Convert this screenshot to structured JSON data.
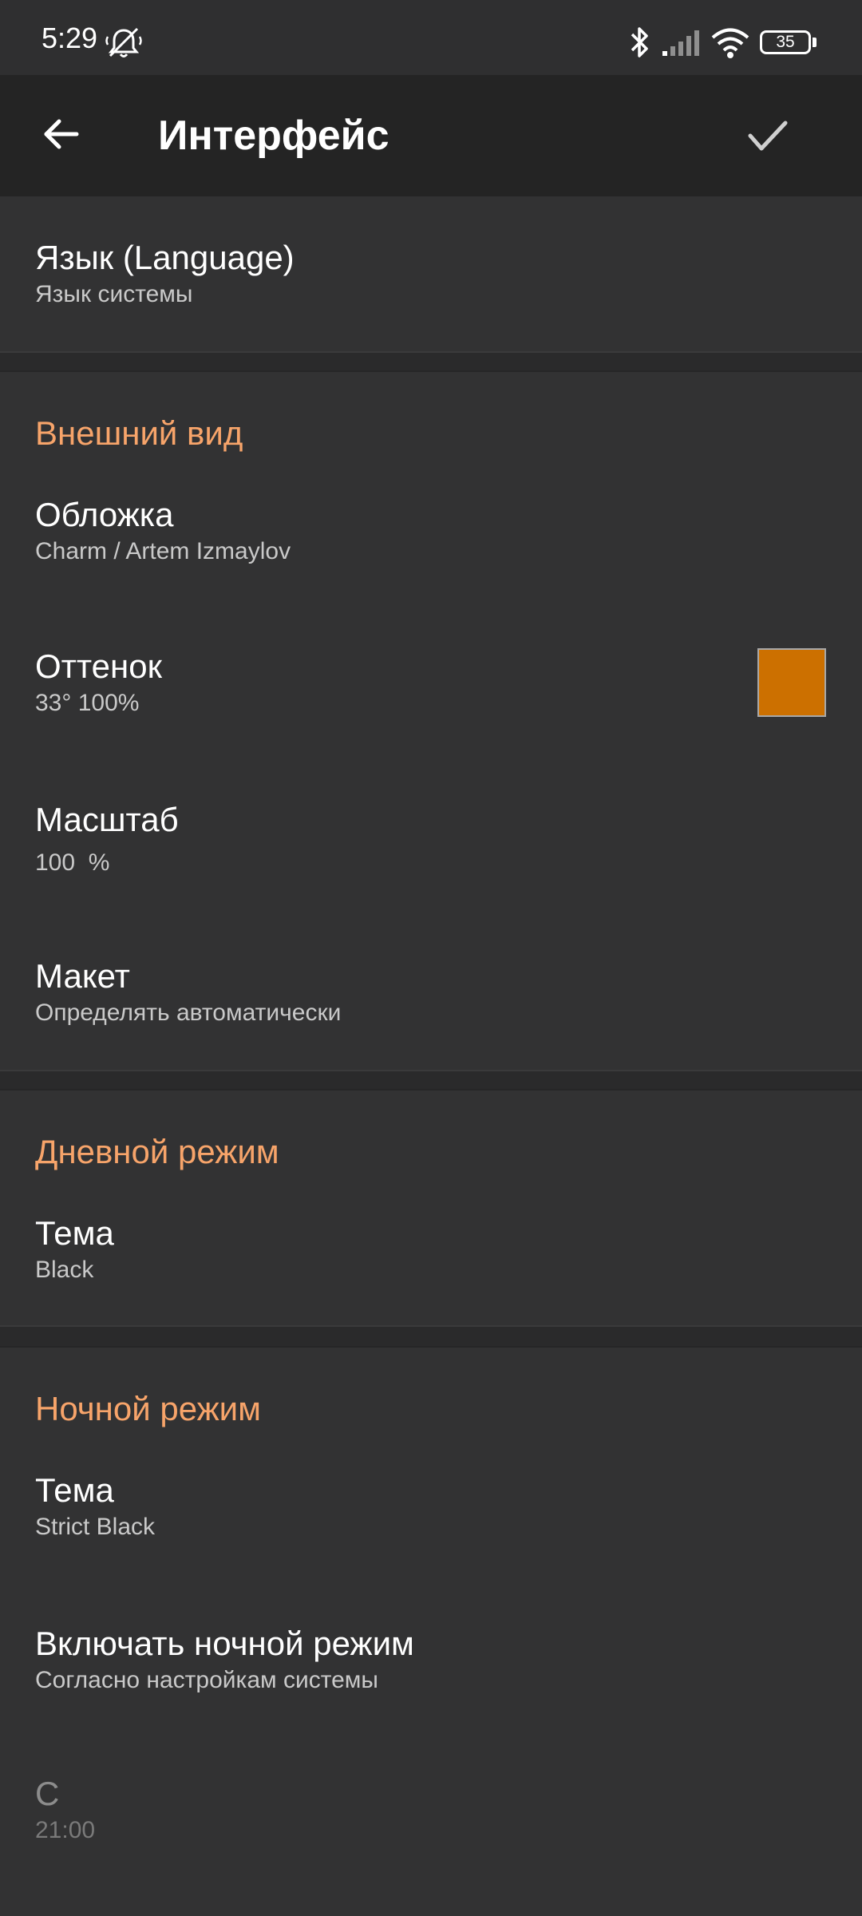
{
  "status_bar": {
    "time": "5:29",
    "battery": "35",
    "icons": [
      "mute-icon",
      "bluetooth-icon",
      "signal-icon",
      "wifi-icon",
      "battery-icon"
    ]
  },
  "app_bar": {
    "title": "Интерфейс",
    "back_icon": "arrow-left-icon",
    "confirm_icon": "check-icon"
  },
  "language": {
    "title": "Язык (Language)",
    "value": "Язык системы"
  },
  "appearance": {
    "header": "Внешний вид",
    "cover": {
      "title": "Обложка",
      "value": "Charm / Artem Izmaylov"
    },
    "tint": {
      "title": "Оттенок",
      "value": "33° 100%",
      "color": "#cc7000"
    },
    "scale": {
      "title": "Масштаб",
      "value": "100  %"
    },
    "layout": {
      "title": "Макет",
      "value": "Определять автоматически"
    }
  },
  "day_mode": {
    "header": "Дневной режим",
    "theme": {
      "title": "Тема",
      "value": "Black"
    }
  },
  "night_mode": {
    "header": "Ночной режим",
    "theme": {
      "title": "Тема",
      "value": "Strict Black"
    },
    "enable": {
      "title": "Включать ночной режим",
      "value": "Согласно настройкам системы"
    },
    "from": {
      "title": "С",
      "value": "21:00"
    }
  },
  "colors": {
    "accent": "#f7a46a",
    "background": "#2f2f30",
    "app_bar": "#242424"
  }
}
